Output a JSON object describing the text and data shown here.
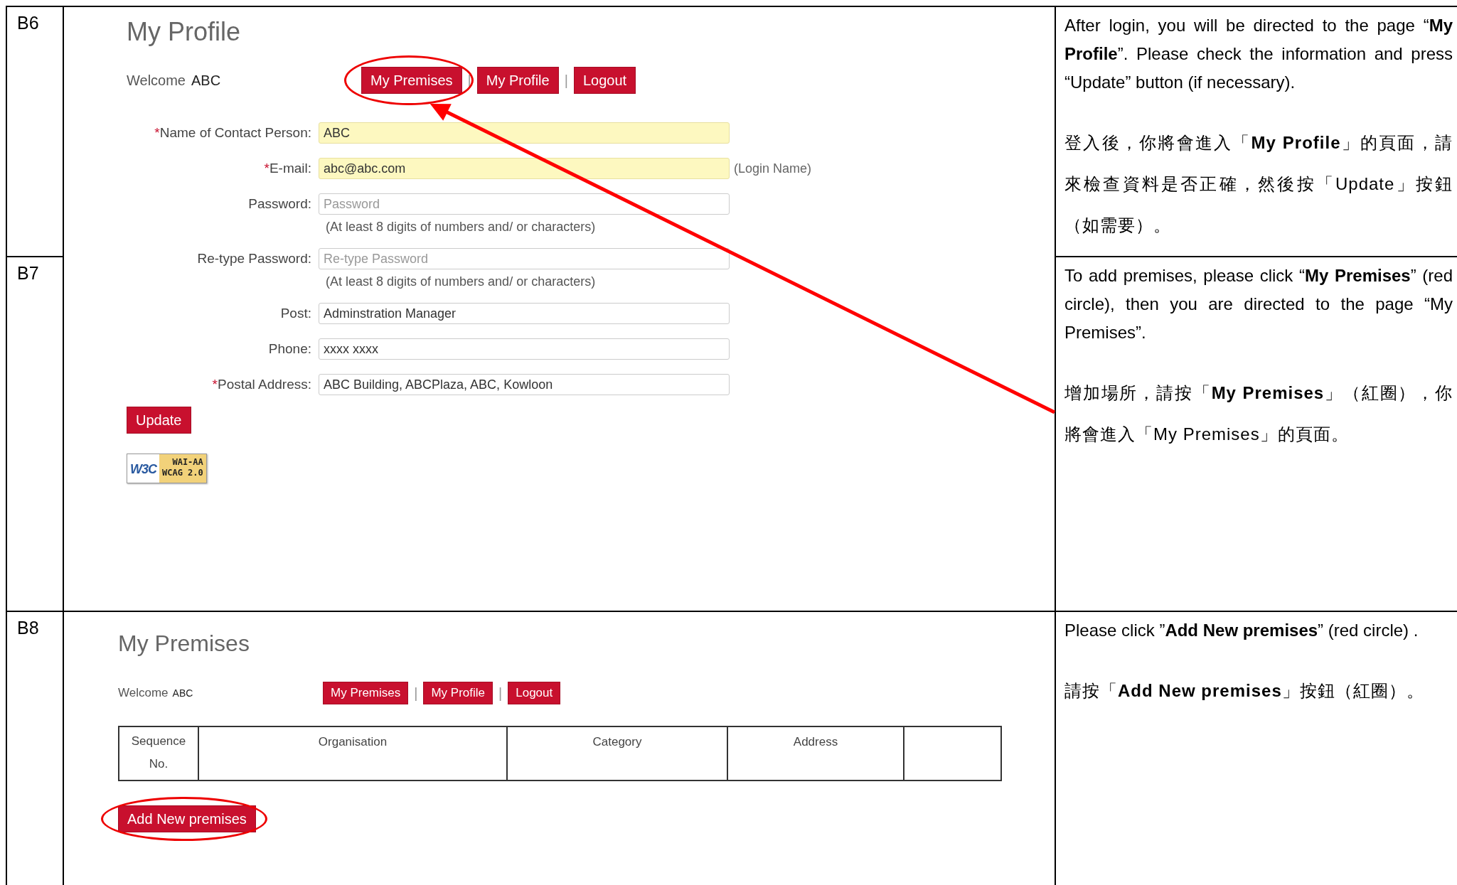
{
  "steps": [
    {
      "label": "B6"
    },
    {
      "label": "B7"
    },
    {
      "label": "B8"
    }
  ],
  "profile_screen": {
    "title": "My Profile",
    "welcome_label": "Welcome",
    "user_name": "ABC",
    "nav": [
      {
        "kind": "button",
        "label": "My Premises",
        "circled": true
      },
      {
        "kind": "separator",
        "label": "|"
      },
      {
        "kind": "button",
        "label": "My Profile",
        "circled": false
      },
      {
        "kind": "separator",
        "label": "|"
      },
      {
        "kind": "button",
        "label": "Logout",
        "circled": false
      }
    ],
    "fields": [
      {
        "required_mark": "*",
        "label": "Name of Contact Person:",
        "value": "ABC",
        "autofilled": true
      },
      {
        "required_mark": "*",
        "label": "E-mail:",
        "value": "abc@abc.com",
        "autofilled": true,
        "note": "(Login Name)"
      },
      {
        "label": "Password:",
        "placeholder": "Password",
        "autofilled": false,
        "hint": "(At least 8 digits of numbers and/ or characters)"
      },
      {
        "label": "Re-type Password:",
        "placeholder": "Re-type Password",
        "autofilled": false,
        "hint": "(At least 8 digits of numbers and/ or characters)"
      },
      {
        "label": "Post:",
        "value": "Adminstration Manager",
        "autofilled": false
      },
      {
        "label": "Phone:",
        "value": "xxxx xxxx",
        "autofilled": false
      },
      {
        "required_mark": "*",
        "label": "Postal Address:",
        "value": "ABC Building, ABCPlaza, ABC, Kowloon",
        "autofilled": false
      }
    ],
    "update_button": "Update",
    "badge": {
      "logo": "W3C",
      "level": "WAI-AA",
      "standard": "WCAG 2.0"
    }
  },
  "premises_screen": {
    "title": "My Premises",
    "welcome_label": "Welcome",
    "user_name": "ABC",
    "nav": [
      {
        "kind": "button",
        "label": "My Premises",
        "circled": false
      },
      {
        "kind": "separator",
        "label": "|"
      },
      {
        "kind": "button",
        "label": "My Profile",
        "circled": false
      },
      {
        "kind": "separator",
        "label": "|"
      },
      {
        "kind": "button",
        "label": "Logout",
        "circled": false
      }
    ],
    "table": {
      "columns": [
        "Sequence No.",
        "Organisation",
        "Category",
        "Address",
        null
      ]
    },
    "add_button": {
      "label": "Add New premises",
      "circled": true
    }
  },
  "instructions": [
    {
      "english": "After login, you will be directed to the page “**My Profile**”. Please check the information and press “Update” button (if necessary).",
      "chinese": "登入後，你將會進入「**My Profile**」的頁面，請來檢查資料是否正確，然後按「Update」按鈕（如需要）。"
    },
    {
      "english": "To add premises, please click “**My Premises**” (red circle), then you are directed to the page “My Premises”.",
      "chinese": "增加場所，請按「**My Premises**」（紅圈），你將會進入「My Premises」的頁面。"
    },
    {
      "english": "Please click ”**Add New premises**” (red circle) .",
      "chinese": "請按「**Add New premises**」按鈕（紅圈）。"
    }
  ]
}
